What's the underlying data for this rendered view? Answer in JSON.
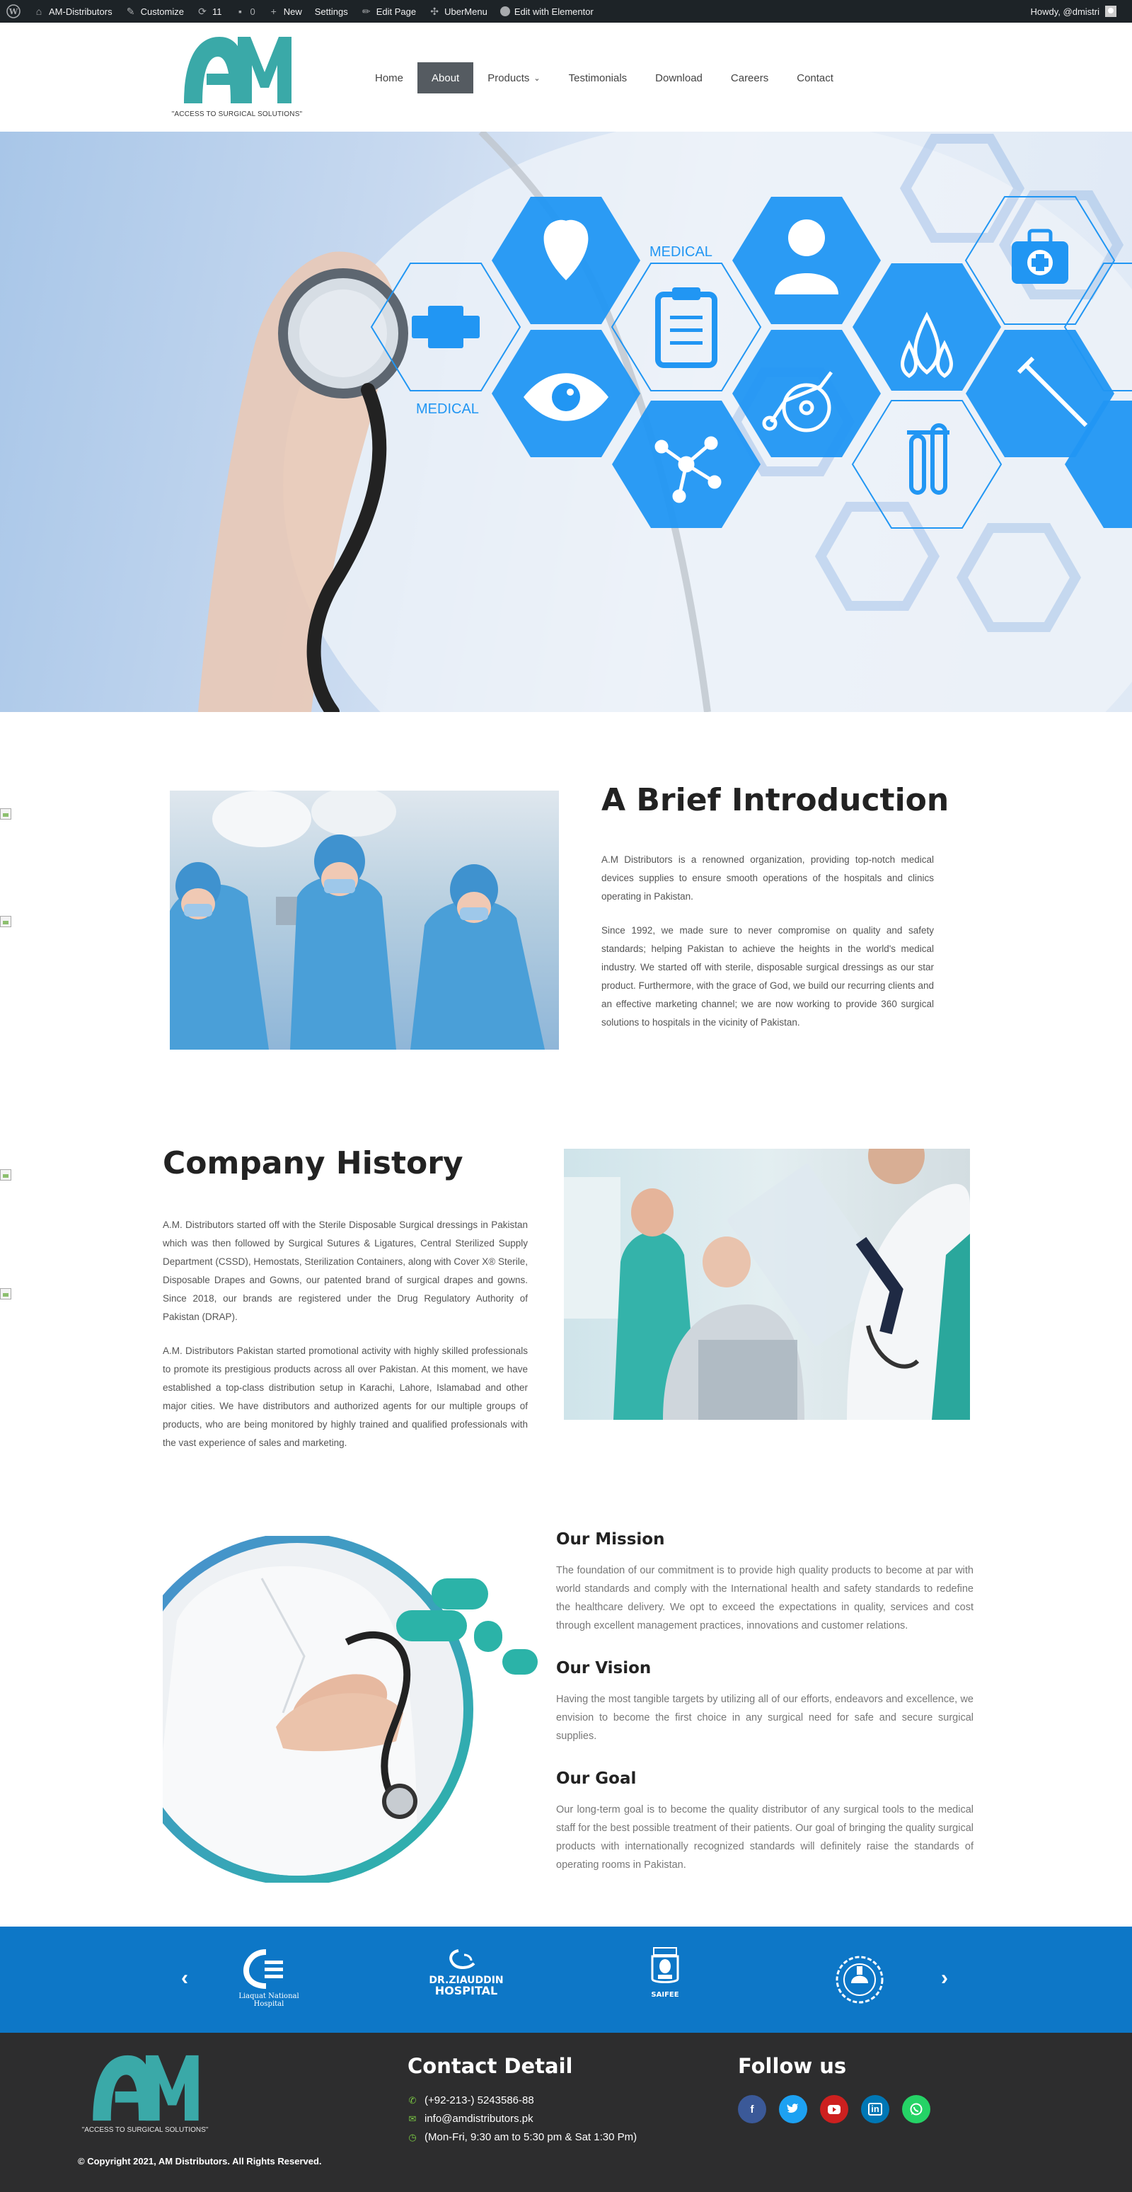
{
  "admin_bar": {
    "site_name": "AM-Distributors",
    "customize": "Customize",
    "updates_count": "11",
    "comments_count": "0",
    "new": "New",
    "settings": "Settings",
    "edit_page": "Edit Page",
    "ubermenu": "UberMenu",
    "elementor": "Edit with Elementor",
    "howdy": "Howdy, @dmistri"
  },
  "header": {
    "logo_tagline": "\"ACCESS TO SURGICAL SOLUTIONS\"",
    "nav": [
      {
        "label": "Home"
      },
      {
        "label": "About",
        "active": true
      },
      {
        "label": "Products",
        "has_dropdown": true
      },
      {
        "label": "Testimonials"
      },
      {
        "label": "Download"
      },
      {
        "label": "Careers"
      },
      {
        "label": "Contact"
      }
    ]
  },
  "hero": {
    "medical_label_top": "MEDICAL",
    "medical_label_left": "MEDICAL"
  },
  "intro": {
    "title": "A Brief Introduction",
    "paragraphs": [
      "A.M Distributors is a renowned organization, providing top-notch medical devices supplies to ensure smooth operations of the hospitals and clinics operating in Pakistan.",
      "Since 1992, we made sure to never compromise on quality and safety standards; helping Pakistan to achieve the heights in the world's medical industry. We started off with sterile, disposable surgical dressings as our star product. Furthermore, with the grace of God, we build our recurring clients and an effective marketing channel; we are now working to provide 360 surgical solutions to hospitals in the vicinity of Pakistan."
    ]
  },
  "history": {
    "title": "Company History",
    "paragraphs": [
      "A.M. Distributors started off with the Sterile Disposable Surgical dressings in Pakistan which was then followed by Surgical Sutures & Ligatures, Central Sterilized Supply Department (CSSD), Hemostats, Sterilization Containers, along with Cover X® Sterile, Disposable Drapes and Gowns, our patented brand of surgical drapes and gowns. Since 2018, our brands are registered under the Drug Regulatory Authority of Pakistan (DRAP).",
      "A.M. Distributors Pakistan started promotional activity with highly skilled professionals to promote its prestigious products across all over Pakistan. At this moment, we have established a top-class distribution setup in Karachi, Lahore, Islamabad and other major cities. We have distributors and authorized agents for our multiple groups of products, who are being monitored by highly trained and qualified professionals with the vast experience of sales and marketing."
    ]
  },
  "mission": {
    "title": "Our Mission",
    "text": "The foundation of our commitment is to provide high quality products to become at par with world standards and comply with the International health and safety standards to redefine the healthcare delivery. We opt to exceed the expectations in quality, services and cost through excellent management practices, innovations and customer relations."
  },
  "vision": {
    "title": "Our Vision",
    "text": "Having the most tangible targets by utilizing all of our efforts, endeavors and excellence, we envision to become the first choice in any surgical need for safe and secure surgical supplies."
  },
  "goal": {
    "title": "Our Goal",
    "text": "Our long-term goal is to become the quality distributor of any surgical tools to the medical staff for the best possible treatment of their patients. Our goal of bringing the quality surgical products with internationally recognized standards will definitely raise the standards of operating rooms in Pakistan."
  },
  "partners": {
    "prev": "‹",
    "next": "›",
    "items": [
      {
        "name": "Liaquat National Hospital"
      },
      {
        "name_line1": "DR.ZIAUDDIN",
        "name_line2": "HOSPITAL"
      },
      {
        "name": "SAIFEE"
      }
    ]
  },
  "footer": {
    "logo_tagline": "\"ACCESS TO SURGICAL SOLUTIONS\"",
    "contact_title": "Contact Detail",
    "phone": "(+92-213-) 5243586-88",
    "email": "info@amdistributors.pk",
    "hours": "(Mon-Fri, 9:30 am to 5:30 pm & Sat 1:30 Pm)",
    "follow_title": "Follow us",
    "copyright": "© Copyright 2021, AM Distributors. All Rights Reserved.",
    "social": [
      {
        "icon": "facebook-icon",
        "color": "#3b5998"
      },
      {
        "icon": "twitter-icon",
        "color": "#1da1f2"
      },
      {
        "icon": "youtube-icon",
        "color": "#cd201f"
      },
      {
        "icon": "linkedin-icon",
        "color": "#0077b5"
      },
      {
        "icon": "whatsapp-icon",
        "color": "#25d366"
      }
    ]
  },
  "colors": {
    "brand_teal": "#3aa9a8",
    "partners_bg": "#0d77c7",
    "footer_bg": "#2d2d2e",
    "nav_active": "#555b61",
    "hex_blue": "#2196f3"
  }
}
